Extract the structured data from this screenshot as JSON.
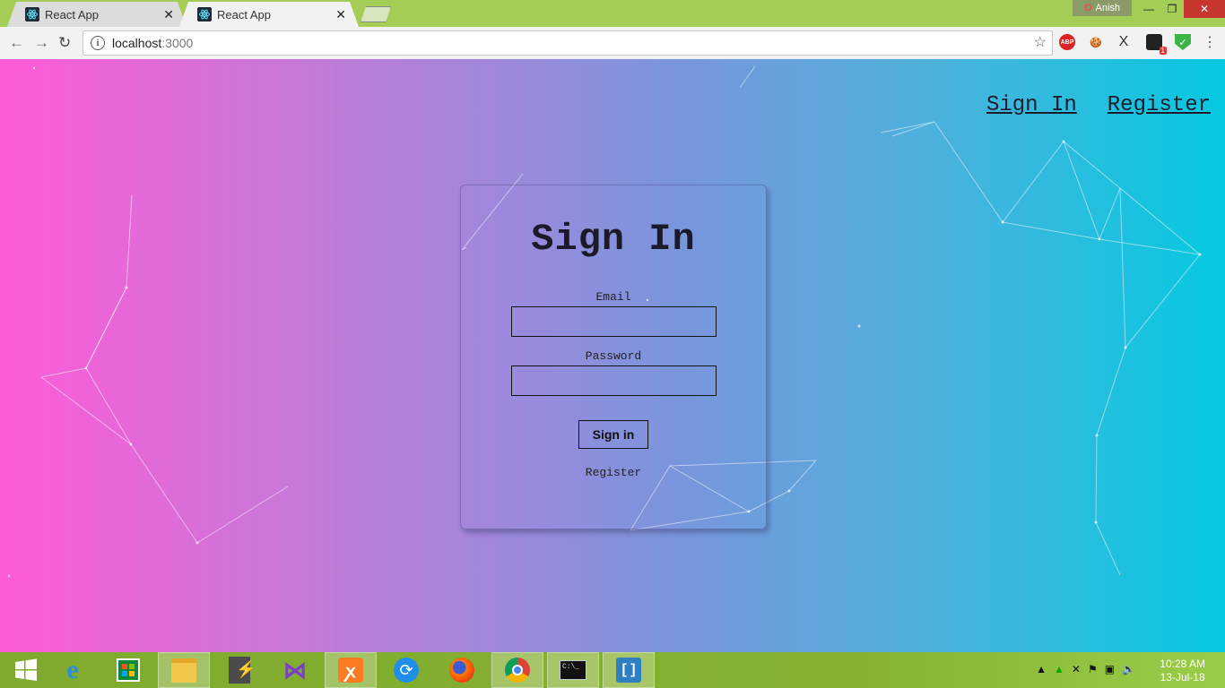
{
  "browser": {
    "tabs": [
      {
        "title": "React App",
        "active": false
      },
      {
        "title": "React App",
        "active": true
      }
    ],
    "profile_name": "Anish",
    "address": {
      "host": "localhost",
      "port": ":3000"
    },
    "extensions": [
      {
        "name": "abp-icon",
        "label": "ABP"
      },
      {
        "name": "cookie-icon",
        "label": "🍪"
      },
      {
        "name": "x-extension-icon",
        "label": "X"
      },
      {
        "name": "notification-extension-icon",
        "label": "1"
      },
      {
        "name": "shield-check-icon",
        "label": "✓"
      }
    ]
  },
  "page": {
    "nav": {
      "sign_in": "Sign In",
      "register": "Register"
    },
    "card": {
      "title": "Sign In",
      "email_label": "Email",
      "password_label": "Password",
      "submit_label": "Sign in",
      "register_link": "Register"
    }
  },
  "taskbar": {
    "apps": [
      "start-icon",
      "internet-explorer-icon",
      "store-icon",
      "file-explorer-icon",
      "sublime-icon",
      "visual-studio-icon",
      "xampp-icon",
      "sync-icon",
      "firefox-icon",
      "chrome-icon",
      "cmd-icon",
      "brackets-icon"
    ],
    "time": "10:28 AM",
    "date": "13-Jul-18"
  },
  "colors": {
    "gradient_left": "#ff5bd8",
    "gradient_right": "#05c9e0",
    "taskbar": "#86b230",
    "titlebar": "#a3cd55"
  }
}
